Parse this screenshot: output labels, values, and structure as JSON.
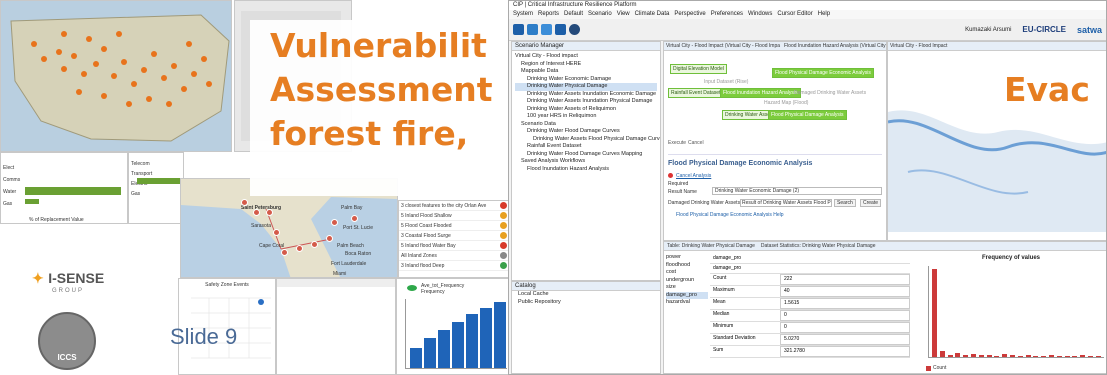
{
  "slide": {
    "title_lines": [
      "Vulnerabilit",
      "Assessment",
      "forest fire, "
    ],
    "evac_text": "Evac",
    "slide_number": "Slide 9",
    "title_color": "#e67e22"
  },
  "logos": {
    "isense": "I-SENSE",
    "isense_sub": "GROUP",
    "iccs": "ICCS"
  },
  "app": {
    "window_title": "CIP | Critical Infrastructure Resilience Platform",
    "menu": [
      "System",
      "Reports",
      "Default",
      "Scenario",
      "View",
      "Climate Data",
      "Perspective",
      "Preferences",
      "Windows",
      "Cursor Editor",
      "Help"
    ],
    "user": "Kumazaki Arsumi",
    "partner1": "EU-CIRCLE",
    "partner2": "satwa",
    "scenario_tab": "Scenario Manager",
    "tree": [
      "Virtual City - Flood impact",
      "Region of Interest HERE",
      "Mappable Data",
      "Drinking Water Economic Damage",
      "Drinking Water Physical Damage",
      "Drinking Water Assets Inundation Economic Damage",
      "Drinking Water Assets Inundation Physical Damage",
      "Drinking Water Assets of Reliquimon",
      "100 year HRS in Reliquimon",
      "Scenario Data",
      "Drinking Water Flood Damage Curves",
      "Drinking Water Assets Flood Physical Damage Curves",
      "Rainfall Event Dataset",
      "Drinking Water Flood Damage Curves Mapping",
      "Saved Analysis Workflows",
      "Flood Inundation Hazard Analysis"
    ],
    "catalog_tab": "Catalog",
    "catalog_items": [
      "Local Cache",
      "Public Repository"
    ],
    "workflow_tab1": "Virtual City - Flood Impact (Virtual City - Flood Impa",
    "workflow_tab2": "Flood Inundation Hazard Analysis (Virtual City - Floo",
    "map_tab": "Virtual City - Flood Impact",
    "nodes": [
      "Digital Elevation Model",
      "Rainfall Event Dataset",
      "Flood Inundation Hazard Analysis",
      "Flood Physical Damage Economic Analysis",
      "Drinking Water Assets",
      "Flood Physical Damage Analysis"
    ],
    "edge_labels": [
      "Input Dataset (Rise)",
      "Damaged Drinking Water Assets",
      "Hazard Map (Flood)"
    ],
    "execute_btn": "Execute",
    "cancel_btn": "Cancel",
    "analysis_title": "Flood Physical Damage Economic Analysis",
    "cancel_analysis": "Cancel Analysis",
    "required": "Required",
    "result_name_label": "Result Name",
    "result_name_value": "Drinking Water Economic Damage (2)",
    "damaged_label": "Damaged Drinking Water Assets",
    "damaged_value": "Result of Drinking Water Assets Flood Physical Damage",
    "search_btn": "Search",
    "create_btn": "Create",
    "help_link": "Flood Physical Damage Economic Analysis Help",
    "bottom_tab1": "Table: Drinking Water Physical Damage",
    "bottom_tab2": "Dataset Statistics: Drinking Water Physical Damage",
    "fields": [
      "power",
      "floodhood",
      "cost",
      "undergroun",
      "size",
      "damage_pro",
      "hazardval"
    ],
    "stats_header1": "damage_pro",
    "stats_header2": "damage_pro",
    "stats": [
      {
        "label": "Count",
        "value": "222"
      },
      {
        "label": "Maximum",
        "value": "40"
      },
      {
        "label": "Mean",
        "value": "1.5615"
      },
      {
        "label": "Median",
        "value": "0"
      },
      {
        "label": "Minimum",
        "value": "0"
      },
      {
        "label": "Standard Deviation",
        "value": "5.0270"
      },
      {
        "label": "Sum",
        "value": "321.2780"
      }
    ],
    "hist_title": "Frequency of values",
    "hist_legend": "Count"
  },
  "left_panels": {
    "chart_labels": [
      "Elect",
      "Comms",
      "Water",
      "Gas"
    ],
    "bottom_label": "% of Replacement Value",
    "right_labels": [
      "Telecom",
      "Transport",
      "Electric",
      "Gas",
      "Water"
    ],
    "map_labels": [
      "Saint Petersburg",
      "Sarasota",
      "Cape Coral",
      "Palm Bay",
      "Port St. Lucie",
      "Palm Beach",
      "Boca Raton",
      "Fort Lauderdale",
      "Miami"
    ],
    "list_items": [
      "3 closest features to the city Orlan Ave",
      "5 Inland Flood Shallow",
      "5 Flood Coast Flooded",
      "3 Coastal Flood Surge",
      "5 Inland flood Water Bay",
      "All Inland Zones",
      "3 Inland flood Deep"
    ],
    "scatter_title": "Safety Zone Events",
    "legend_a": "Ave_tot_Frequency",
    "legend_b": "Frequency"
  },
  "colors": {
    "accent_orange": "#e67e22",
    "bar_green": "#6aa033",
    "node_green": "#7ccc3c",
    "hist_red": "#cc3a3a",
    "bar_blue": "#1f64b8"
  }
}
